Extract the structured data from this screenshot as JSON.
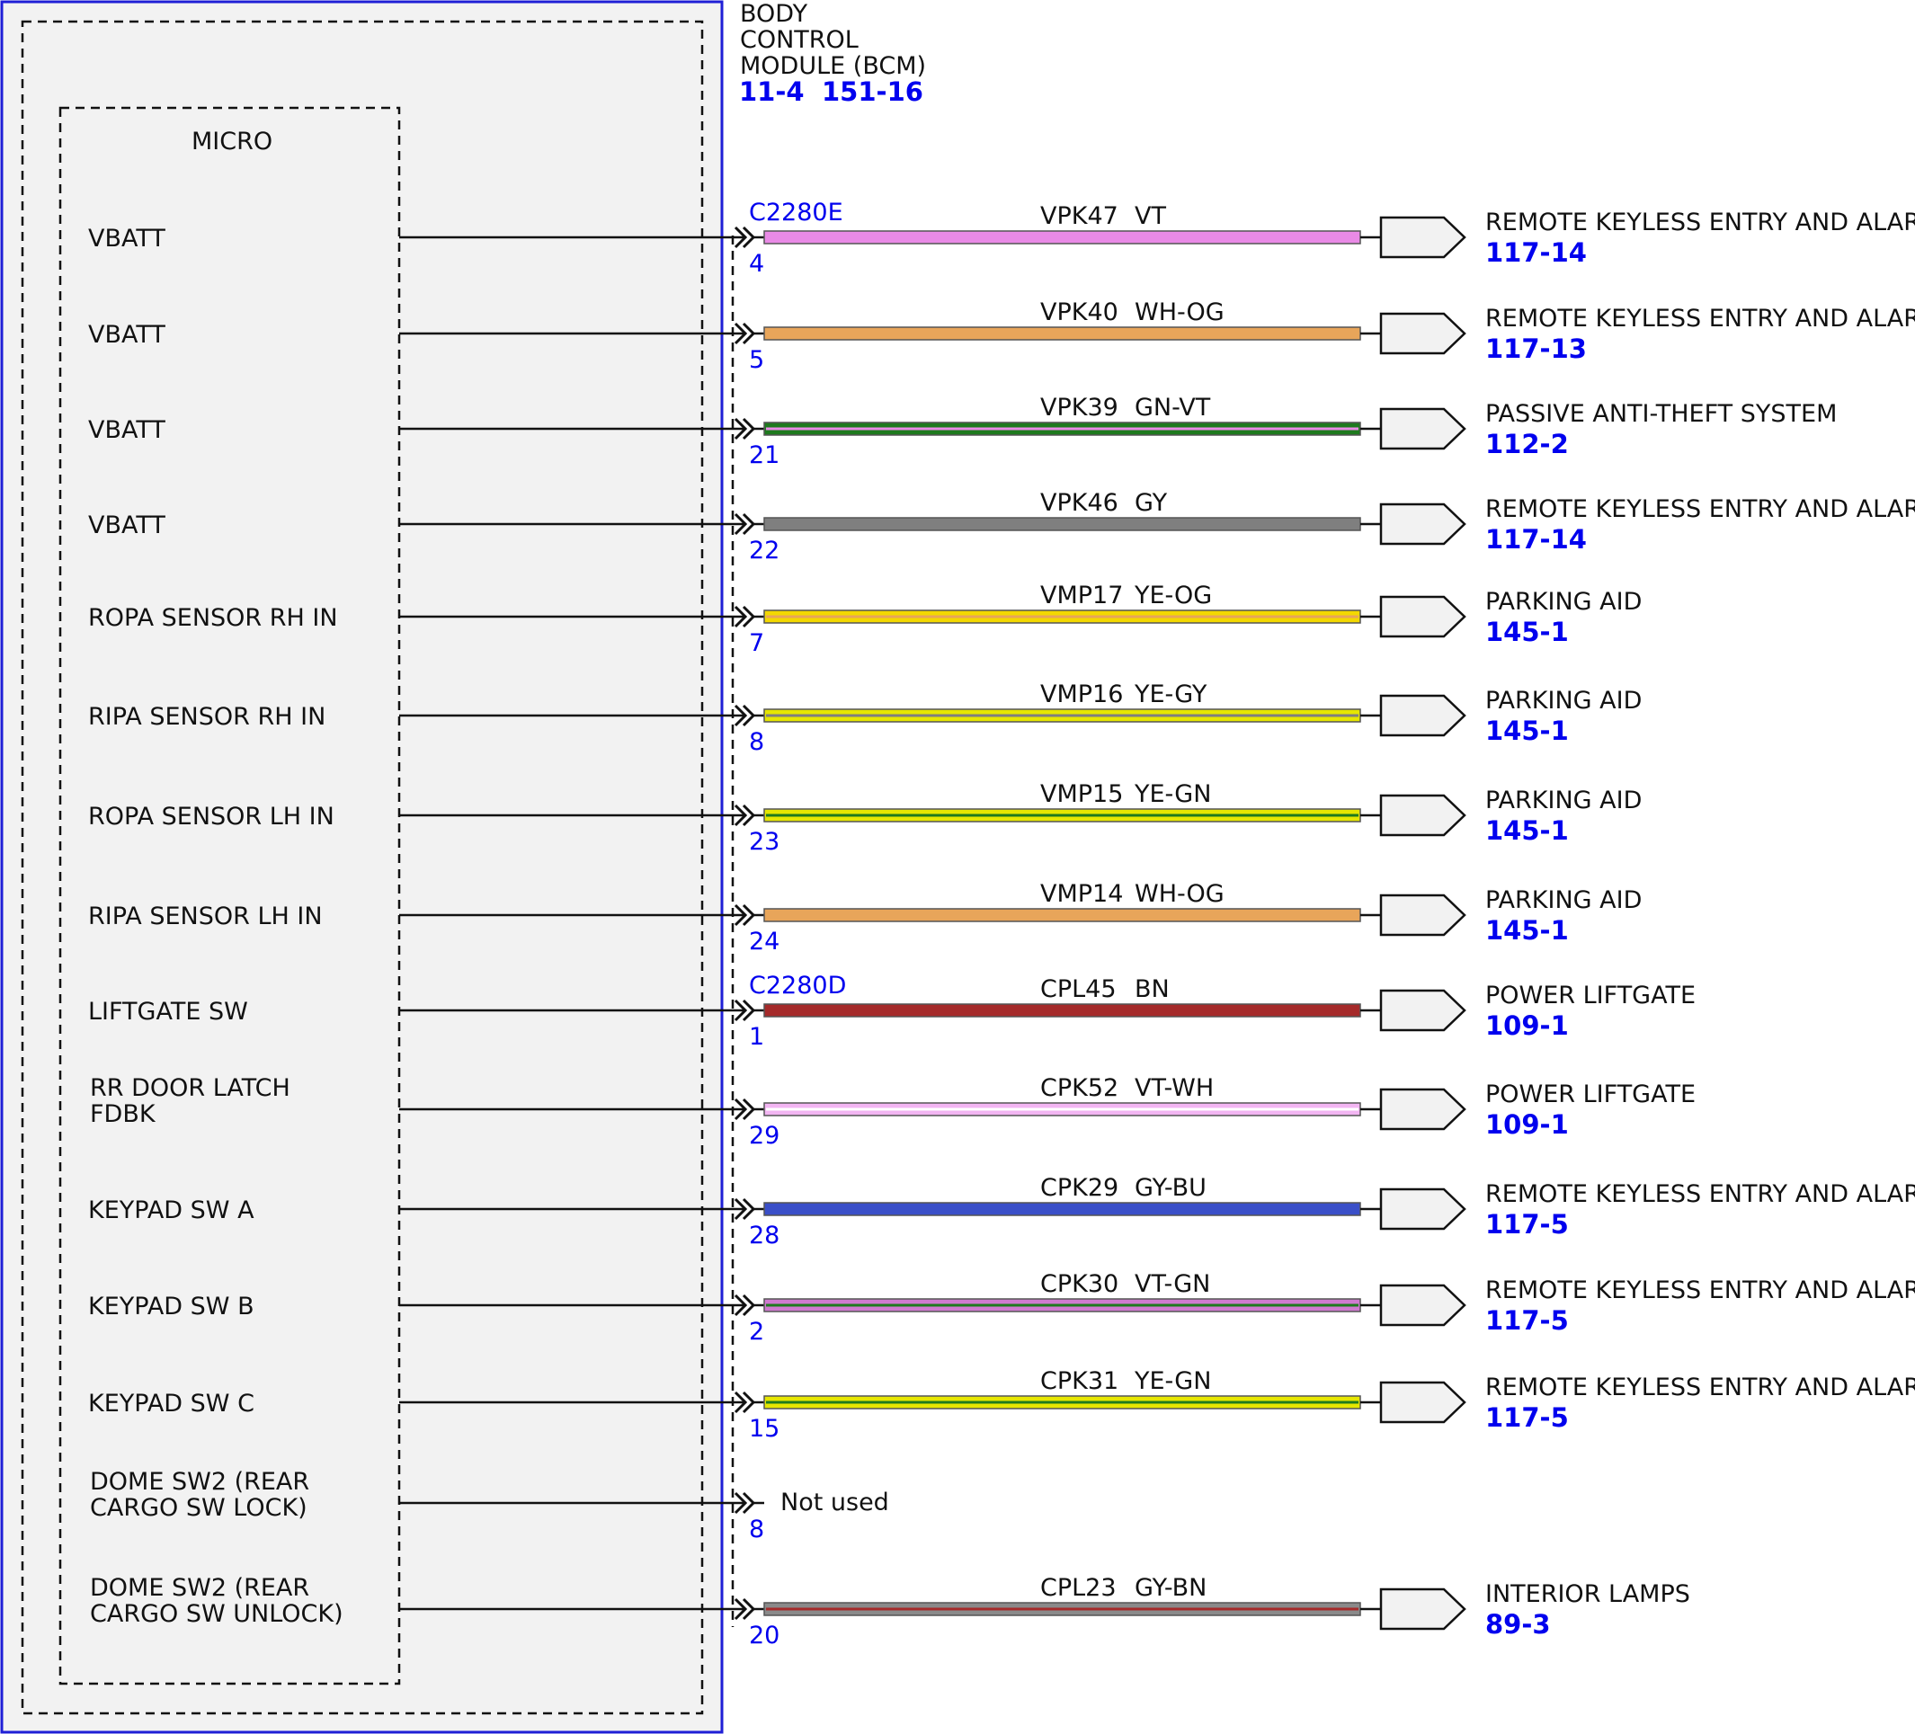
{
  "module": {
    "title_lines": [
      "BODY",
      "CONTROL",
      "MODULE (BCM)"
    ],
    "refs": [
      "11-4",
      "151-16"
    ],
    "micro_label": "MICRO"
  },
  "colors": {
    "module_border": "#1f1fd6",
    "module_fill": "#f2f2f2",
    "ref_text": "#0000ee",
    "VT": "#e98ae6",
    "WH-OG": "#e8a55a",
    "GN-VT": "#1e7a1e",
    "GY": "#7f7f7f",
    "YE-OG": "#f3d800",
    "YE-GY": "#e6e600",
    "YE-GN": "#e6e600",
    "BN": "#a52a2a",
    "VT-WH": "#f2b5f2",
    "GY-BU": "#3a4fc8",
    "VT-GN": "#d07ad0",
    "GY-BN": "#8a8a8a"
  },
  "circuits": [
    {
      "signal": [
        "VBATT"
      ],
      "connector": "C2280E",
      "pin": "4",
      "circuit": "VPK47",
      "color": "VT",
      "dest": "REMOTE KEYLESS ENTRY AND ALARM",
      "dest_ref": "117-14"
    },
    {
      "signal": [
        "VBATT"
      ],
      "pin": "5",
      "circuit": "VPK40",
      "color": "WH-OG",
      "dest": "REMOTE KEYLESS ENTRY AND ALARM",
      "dest_ref": "117-13"
    },
    {
      "signal": [
        "VBATT"
      ],
      "pin": "21",
      "circuit": "VPK39",
      "color": "GN-VT",
      "dest": "PASSIVE ANTI-THEFT SYSTEM",
      "dest_ref": "112-2"
    },
    {
      "signal": [
        "VBATT"
      ],
      "pin": "22",
      "circuit": "VPK46",
      "color": "GY",
      "dest": "REMOTE KEYLESS ENTRY AND ALARM",
      "dest_ref": "117-14"
    },
    {
      "signal": [
        "ROPA SENSOR RH IN"
      ],
      "pin": "7",
      "circuit": "VMP17",
      "color": "YE-OG",
      "dest": "PARKING AID",
      "dest_ref": "145-1"
    },
    {
      "signal": [
        "RIPA SENSOR RH IN"
      ],
      "pin": "8",
      "circuit": "VMP16",
      "color": "YE-GY",
      "dest": "PARKING AID",
      "dest_ref": "145-1"
    },
    {
      "signal": [
        "ROPA SENSOR LH IN"
      ],
      "pin": "23",
      "circuit": "VMP15",
      "color": "YE-GN",
      "dest": "PARKING AID",
      "dest_ref": "145-1"
    },
    {
      "signal": [
        "RIPA SENSOR LH IN"
      ],
      "pin": "24",
      "circuit": "VMP14",
      "color": "WH-OG",
      "dest": "PARKING AID",
      "dest_ref": "145-1"
    },
    {
      "signal": [
        "LIFTGATE SW"
      ],
      "connector": "C2280D",
      "pin": "1",
      "circuit": "CPL45",
      "color": "BN",
      "dest": "POWER LIFTGATE",
      "dest_ref": "109-1"
    },
    {
      "signal": [
        "RR DOOR LATCH",
        "FDBK"
      ],
      "pin": "29",
      "circuit": "CPK52",
      "color": "VT-WH",
      "dest": "POWER LIFTGATE",
      "dest_ref": "109-1"
    },
    {
      "signal": [
        "KEYPAD SW A"
      ],
      "pin": "28",
      "circuit": "CPK29",
      "color": "GY-BU",
      "dest": "REMOTE KEYLESS ENTRY AND ALARM",
      "dest_ref": "117-5"
    },
    {
      "signal": [
        "KEYPAD SW B"
      ],
      "pin": "2",
      "circuit": "CPK30",
      "color": "VT-GN",
      "dest": "REMOTE KEYLESS ENTRY AND ALARM",
      "dest_ref": "117-5"
    },
    {
      "signal": [
        "KEYPAD SW C"
      ],
      "pin": "15",
      "circuit": "CPK31",
      "color": "YE-GN",
      "dest": "REMOTE KEYLESS ENTRY AND ALARM",
      "dest_ref": "117-5"
    },
    {
      "signal": [
        "DOME SW2 (REAR",
        "CARGO SW LOCK)"
      ],
      "pin": "8",
      "not_used": "Not used"
    },
    {
      "signal": [
        "DOME SW2 (REAR",
        "CARGO SW UNLOCK)"
      ],
      "pin": "20",
      "circuit": "CPL23",
      "color": "GY-BN",
      "dest": "INTERIOR LAMPS",
      "dest_ref": "89-3"
    }
  ]
}
